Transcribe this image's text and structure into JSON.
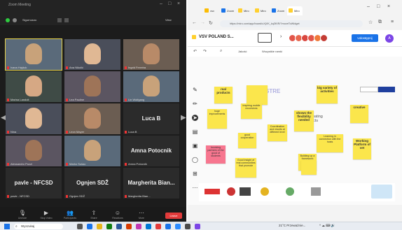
{
  "meeting": {
    "window_title": "Zoom Meeting",
    "header_left_label": "Sigurnosno",
    "view_label": "View",
    "participants": [
      {
        "name": "Ivana Hajduk",
        "selected": true
      },
      {
        "name": "Ana Nikolić"
      },
      {
        "name": "Ingrid Ferreira"
      },
      {
        "name": "Marina Landolt"
      },
      {
        "name": "Lea Pauline"
      },
      {
        "name": "Lin Wolfgang"
      },
      {
        "name": "Nina"
      },
      {
        "name": "Leon Mayer"
      },
      {
        "name": "Luca B",
        "text_only": true
      },
      {
        "name": "Alessandro Pozzi"
      },
      {
        "name": "Marko Sušac"
      },
      {
        "name": "Amna Potocnik",
        "text_only": true
      },
      {
        "name": "pavle - NFCSD",
        "text_only": true
      },
      {
        "name": "Ognjen SDŽ",
        "text_only": true
      },
      {
        "name": "Margherita Bian...",
        "text_only": true
      }
    ],
    "toolbar": [
      "Unmute",
      "Stop Video",
      "Participants",
      "Share",
      "Reactions",
      "More"
    ],
    "leave_label": "Leave"
  },
  "browser": {
    "tabs": [
      "vsv",
      "Zoom",
      "Miro",
      "Miro",
      "Zoom",
      "Miro"
    ],
    "active_tab": 5,
    "url": "https://miro.com/app/board/uXjVK_kq3KIR/?moveToWidget",
    "board_name": "VSV POLAND S...",
    "share_label": "Udostępnij",
    "avatar_letter": "A",
    "sub_toolbar": [
      "Jakość",
      "Wszystkie ramki"
    ]
  },
  "board": {
    "title_words": "STRE",
    "notes": [
      {
        "text": "real products",
        "bold": true
      },
      {
        "text": ""
      },
      {
        "text": "big variety of activities",
        "bold": true
      },
      {
        "text": "inspiring mobile excursions"
      },
      {
        "text": "huge improvements"
      },
      {
        "text": "shows the flexibility needed",
        "bold": true
      },
      {
        "text": "creative",
        "bold": true
      },
      {
        "text": "Coordination and results at different level"
      },
      {
        "text": "good cooperation"
      },
      {
        "text": "Working Platform of vet",
        "bold": true
      },
      {
        "text": "Involving partners of the good of students"
      },
      {
        "text": "Learning in connection with the hosts"
      },
      {
        "text": "Good insight of real communities that promote"
      },
      {
        "text": "Building up a framework"
      },
      {
        "text": ""
      }
    ],
    "secondary_text": "reating ucts"
  },
  "taskbar": {
    "search_label": "Wyszukaj",
    "tray_text": "21°C  Przeważnie..."
  }
}
